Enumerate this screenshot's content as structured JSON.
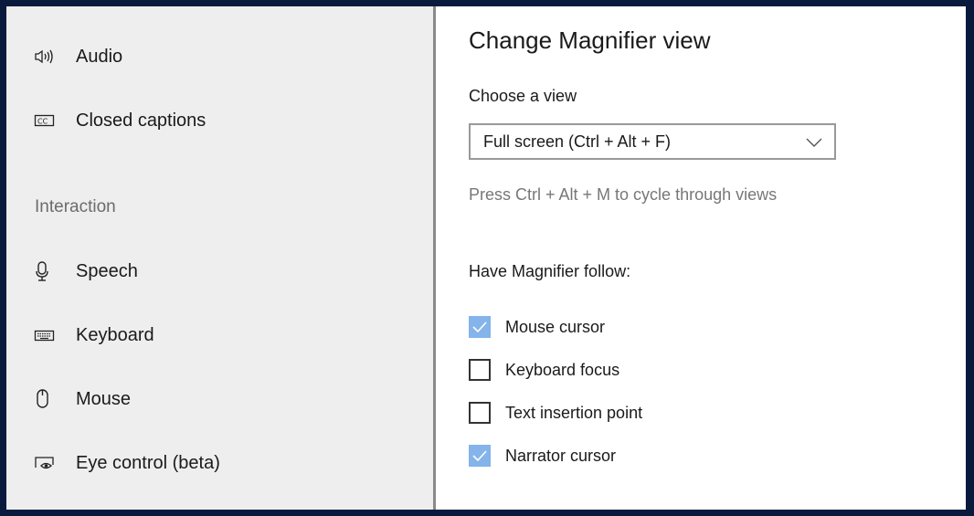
{
  "sidebar": {
    "items": [
      {
        "label": "Audio",
        "icon": "speaker-icon"
      },
      {
        "label": "Closed captions",
        "icon": "closed-captions-icon"
      },
      {
        "label": "Speech",
        "icon": "microphone-icon"
      },
      {
        "label": "Keyboard",
        "icon": "keyboard-icon"
      },
      {
        "label": "Mouse",
        "icon": "mouse-icon"
      },
      {
        "label": "Eye control (beta)",
        "icon": "eye-control-icon"
      }
    ],
    "section_heading": "Interaction"
  },
  "main": {
    "title": "Change Magnifier view",
    "choose_view_label": "Choose a view",
    "view_dropdown": {
      "selected": "Full screen (Ctrl + Alt + F)"
    },
    "hint": "Press Ctrl + Alt + M to cycle through views",
    "follow_label": "Have Magnifier follow:",
    "follow_options": [
      {
        "label": "Mouse cursor",
        "checked": true
      },
      {
        "label": "Keyboard focus",
        "checked": false
      },
      {
        "label": "Text insertion point",
        "checked": false
      },
      {
        "label": "Narrator cursor",
        "checked": true
      }
    ]
  },
  "colors": {
    "checkbox_checked": "#84b4ea",
    "frame_border": "#0a1a3c"
  }
}
